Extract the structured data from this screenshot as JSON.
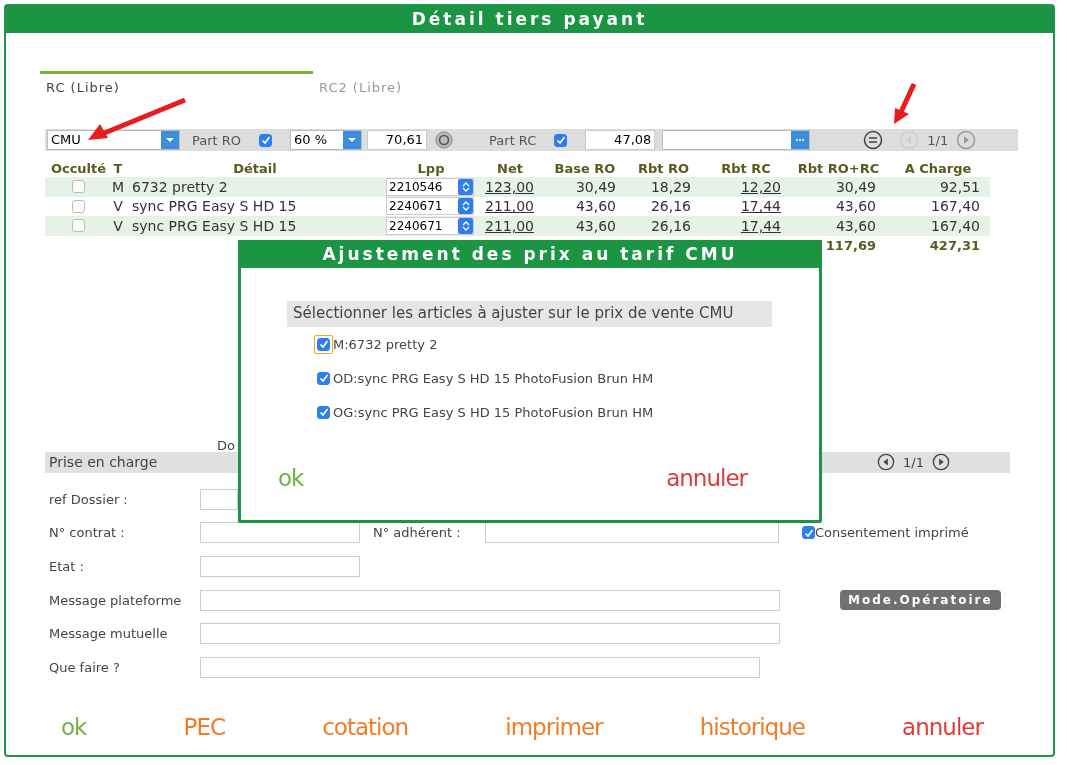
{
  "window": {
    "title": "Détail tiers payant"
  },
  "tabs": [
    {
      "label": "RC (Libre)",
      "selected": true
    },
    {
      "label": "RC2 (Libre)",
      "selected": false
    }
  ],
  "toolbar": {
    "regime": "CMU",
    "part_ro_label": "Part RO",
    "part_ro_checked": true,
    "rate": "60 %",
    "ro_amount": "70,61",
    "part_rc_label": "Part RC",
    "part_rc_checked": true,
    "rc_amount": "47,08",
    "pager": {
      "text": "1/1",
      "prev_disabled": true,
      "next_disabled": false
    }
  },
  "table": {
    "columns": [
      "Occulté",
      "T",
      "Détail",
      "Lpp",
      "Net",
      "Base RO",
      "Rbt RO",
      "Rbt RC",
      "Rbt RO+RC",
      "A Charge"
    ],
    "rows": [
      {
        "hidden": false,
        "type": "M",
        "detail": "6732 pretty 2",
        "lpp": "2210546",
        "net": "123,00",
        "base_ro": "30,49",
        "rbt_ro": "18,29",
        "rbt_rc": "12,20",
        "rbt_ro_rc": "30,49",
        "a_charge": "92,51"
      },
      {
        "hidden": false,
        "type": "V",
        "detail": "sync PRG Easy S HD 15",
        "lpp": "2240671",
        "net": "211,00",
        "base_ro": "43,60",
        "rbt_ro": "26,16",
        "rbt_rc": "17,44",
        "rbt_ro_rc": "43,60",
        "a_charge": "167,40"
      },
      {
        "hidden": false,
        "type": "V",
        "detail": "sync PRG Easy S HD 15",
        "lpp": "2240671",
        "net": "211,00",
        "base_ro": "43,60",
        "rbt_ro": "26,16",
        "rbt_rc": "17,44",
        "rbt_ro_rc": "43,60",
        "a_charge": "167,40"
      }
    ],
    "totals": {
      "rbt_ro_rc": "117,69",
      "a_charge": "427,31"
    }
  },
  "doc_label": "Do",
  "prise_en_charge": {
    "title": "Prise en charge",
    "pager": {
      "text": "1/1",
      "prev_disabled": false,
      "next_disabled": false
    },
    "ref_dossier": "ref Dossier :",
    "contrat": "N° contrat :",
    "adherent": "N° adhérent :",
    "consent": {
      "label": "Consentement imprimé",
      "checked": true
    },
    "etat": "Etat :",
    "message_plateforme": "Message plateforme",
    "mode_button": "Mode.Opératoire",
    "message_mutuelle": "Message mutuelle",
    "que_faire": "Que faire ?"
  },
  "actions": [
    {
      "label": "ok",
      "kind": "ok"
    },
    {
      "label": "PEC",
      "kind": "action"
    },
    {
      "label": "cotation",
      "kind": "action"
    },
    {
      "label": "imprimer",
      "kind": "action"
    },
    {
      "label": "historique",
      "kind": "action"
    },
    {
      "label": "annuler",
      "kind": "cancel"
    }
  ],
  "dialog": {
    "title": "Ajustement des prix au tarif CMU",
    "instruction": "Sélectionner les articles à ajuster sur le prix de vente CMU",
    "items": [
      {
        "label": "M:6732 pretty 2",
        "checked": true,
        "focused": true
      },
      {
        "label": "OD:sync PRG Easy S HD 15 PhotoFusion Brun HM",
        "checked": true,
        "focused": false
      },
      {
        "label": "OG:sync PRG Easy S HD 15 PhotoFusion Brun HM",
        "checked": true,
        "focused": false
      }
    ],
    "ok": {
      "label": "ok",
      "kind": "ok"
    },
    "cancel": {
      "label": "annuler",
      "kind": "cancel"
    }
  }
}
